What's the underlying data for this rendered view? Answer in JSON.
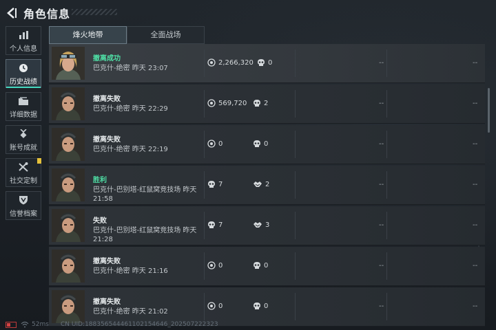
{
  "header": {
    "title": "角色信息"
  },
  "sidebar": {
    "items": [
      {
        "label": "个人信息",
        "icon": "bar-chart-icon",
        "active": false
      },
      {
        "label": "历史战绩",
        "icon": "clock-icon",
        "active": true
      },
      {
        "label": "详细数据",
        "icon": "folder-icon",
        "active": false
      },
      {
        "label": "账号成就",
        "icon": "medal-icon",
        "active": false
      },
      {
        "label": "社交定制",
        "icon": "tools-icon",
        "active": false,
        "badge": true
      },
      {
        "label": "信誉档案",
        "icon": "shield-icon",
        "active": false
      }
    ]
  },
  "tabs": [
    {
      "label": "烽火地带",
      "active": true
    },
    {
      "label": "全面战场",
      "active": false
    }
  ],
  "records": [
    {
      "result": "撤离成功",
      "result_color": "#4fe0a6",
      "map": "巴克什-绝密",
      "time": "昨天 23:07",
      "stat1_icon": "coin-icon",
      "stat1": "2,266,320",
      "stat2_icon": "skull-icon",
      "stat2": "0",
      "dash1": "--",
      "dash2": "--"
    },
    {
      "result": "撤离失败",
      "result_color": "#e6eaec",
      "map": "巴克什-绝密",
      "time": "昨天 22:29",
      "stat1_icon": "coin-icon",
      "stat1": "569,720",
      "stat2_icon": "skull-icon",
      "stat2": "2",
      "dash1": "--",
      "dash2": "--"
    },
    {
      "result": "撤离失败",
      "result_color": "#e6eaec",
      "map": "巴克什-绝密",
      "time": "昨天 22:19",
      "stat1_icon": "coin-icon",
      "stat1": "0",
      "stat2_icon": "skull-icon",
      "stat2": "0",
      "dash1": "--",
      "dash2": "--"
    },
    {
      "result": "胜利",
      "result_color": "#4fe0a6",
      "map": "巴克什-巴别塔-红鼠窝竞技场",
      "time": "昨天 21:58",
      "stat1_icon": "skull-icon",
      "stat1": "7",
      "stat2_icon": "handshake-icon",
      "stat2": "2",
      "dash1": "--",
      "dash2": "--"
    },
    {
      "result": "失败",
      "result_color": "#e6eaec",
      "map": "巴克什-巴别塔-红鼠窝竞技场",
      "time": "昨天 21:28",
      "stat1_icon": "skull-icon",
      "stat1": "7",
      "stat2_icon": "handshake-icon",
      "stat2": "3",
      "dash1": "--",
      "dash2": "--"
    },
    {
      "result": "撤离失败",
      "result_color": "#e6eaec",
      "map": "巴克什-绝密",
      "time": "昨天 21:16",
      "stat1_icon": "coin-icon",
      "stat1": "0",
      "stat2_icon": "skull-icon",
      "stat2": "0",
      "dash1": "--",
      "dash2": "--"
    },
    {
      "result": "撤离失败",
      "result_color": "#e6eaec",
      "map": "巴克什-绝密",
      "time": "昨天 21:02",
      "stat1_icon": "coin-icon",
      "stat1": "0",
      "stat2_icon": "skull-icon",
      "stat2": "0",
      "dash1": "--",
      "dash2": "--"
    }
  ],
  "footer": {
    "ping": "52ms",
    "uid": "CN UID:188356544461102154646_202507222323"
  }
}
